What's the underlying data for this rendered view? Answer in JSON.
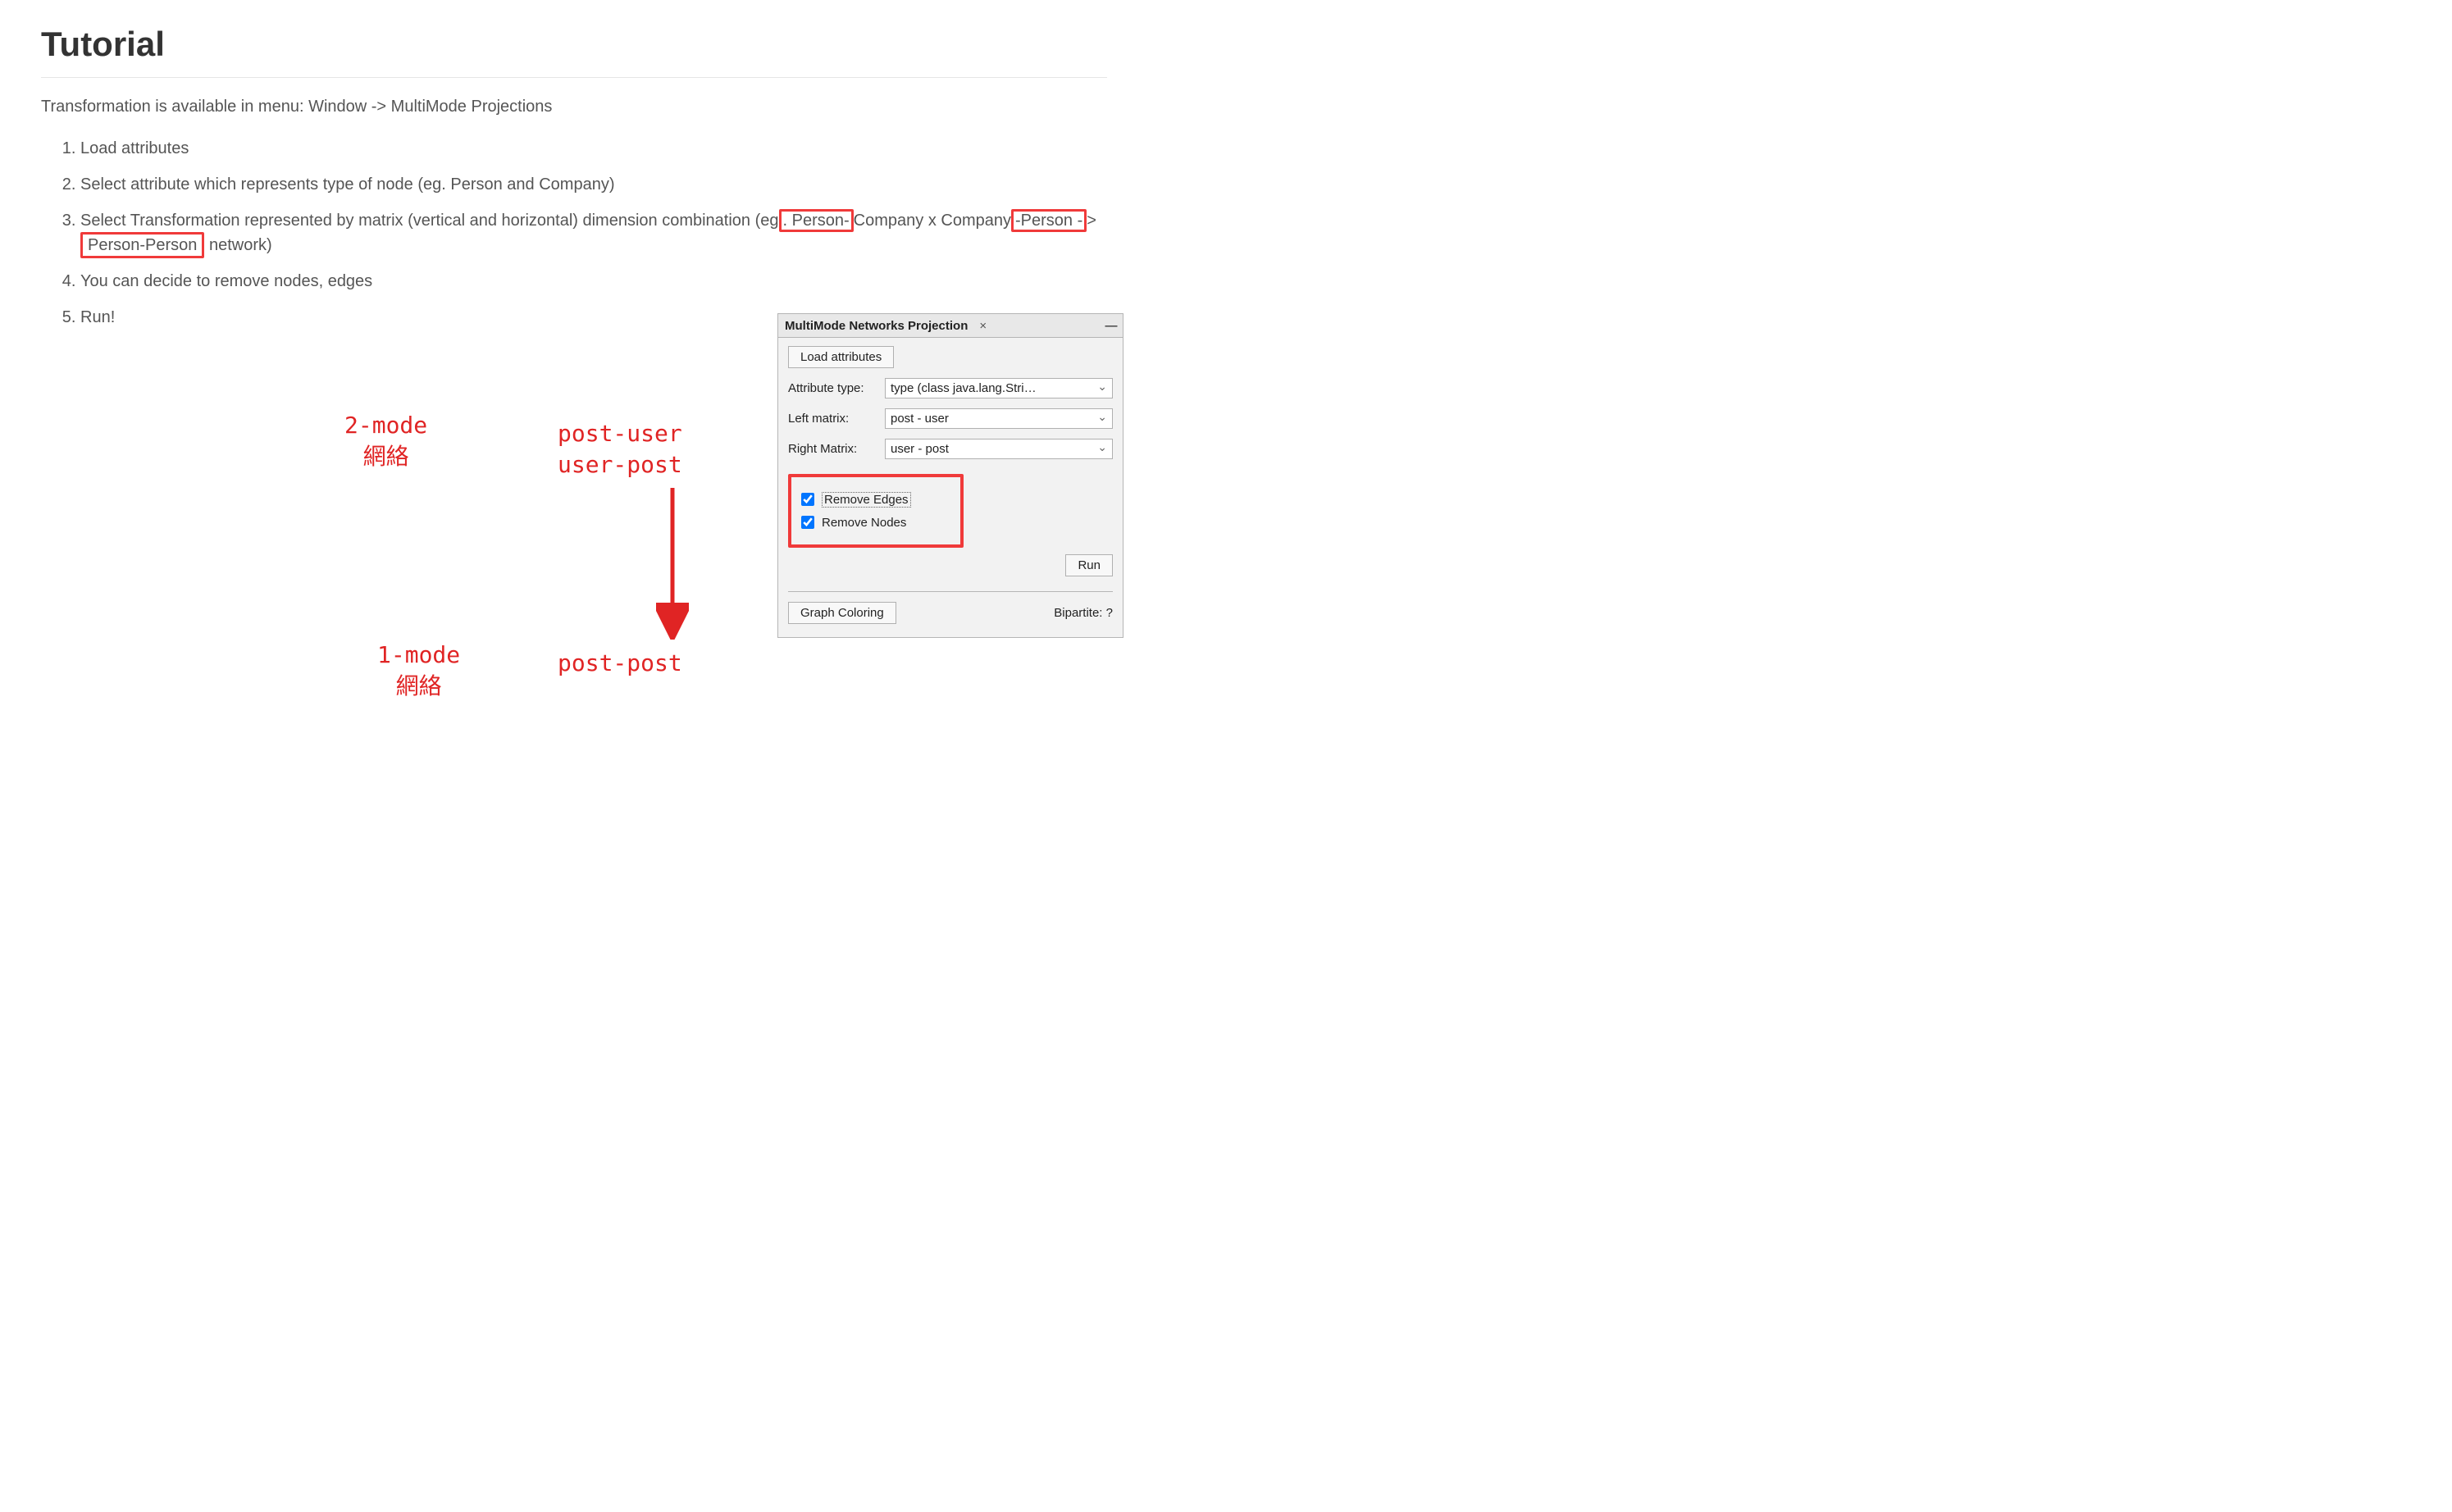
{
  "heading": "Tutorial",
  "intro": "Transformation is available in menu: Window -> MultiMode Projections",
  "steps": {
    "s1": "Load attributes",
    "s2": "Select attribute which represents type of node (eg. Person and Company)",
    "s3_a": "Select Transformation represented by matrix (vertical and horizontal) dimension combination (eg",
    "s3_person1": ". Person-",
    "s3_b": "Company x Company",
    "s3_person2": "-Person -",
    "s3_arrow": ">",
    "s3_pp": "Person-Person",
    "s3_c": " network)",
    "s4": "You can decide to remove nodes, edges",
    "s5": "Run!"
  },
  "annot": {
    "two_mode_l1": "2-mode",
    "two_mode_l2": "網絡",
    "one_mode_l1": "1-mode",
    "one_mode_l2": "網絡",
    "postuser_l1": "post-user",
    "postuser_l2": "user-post",
    "postpost": "post-post"
  },
  "panel": {
    "title": "MultiMode Networks Projection",
    "close": "×",
    "min": "—",
    "load_btn": "Load attributes",
    "attr_label": "Attribute type:",
    "attr_value": "type (class java.lang.Stri…",
    "left_label": "Left matrix:",
    "left_value": "post - user",
    "right_label": "Right Matrix:",
    "right_value": "user - post",
    "remove_edges": "Remove Edges",
    "remove_nodes": "Remove Nodes",
    "run": "Run",
    "graph_coloring": "Graph Coloring",
    "bipartite": "Bipartite: ?"
  }
}
